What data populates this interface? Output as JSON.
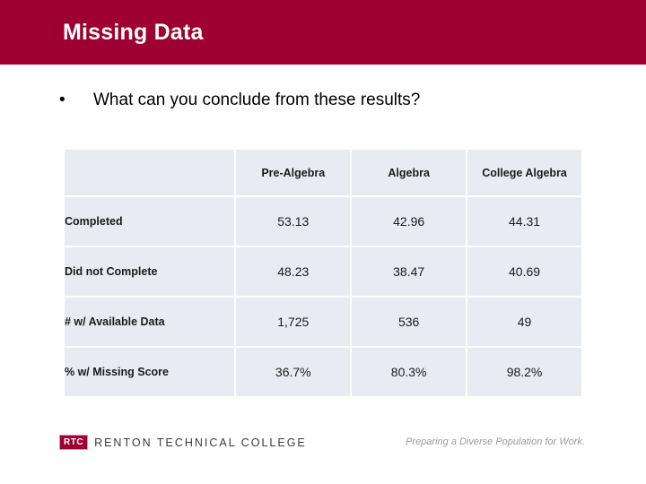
{
  "slide": {
    "title": "Missing Data",
    "banner_color": "#9E0033",
    "background_color": "#FFFFFF"
  },
  "body": {
    "bullet_marker": "•",
    "bullet_text": "What can you conclude from these results?"
  },
  "table": {
    "corner_label": "",
    "columns": [
      "Pre-Algebra",
      "Algebra",
      "College Algebra"
    ],
    "cell_background": "#E8ECF2",
    "rows": [
      {
        "label": "Completed",
        "values": [
          "53.13",
          "42.96",
          "44.31"
        ]
      },
      {
        "label": "Did not Complete",
        "values": [
          "48.23",
          "38.47",
          "40.69"
        ]
      },
      {
        "label": "# w/ Available Data",
        "values": [
          "1,725",
          "536",
          "49"
        ]
      },
      {
        "label": "% w/ Missing Score",
        "values": [
          "36.7%",
          "80.3%",
          "98.2%"
        ]
      }
    ]
  },
  "footer": {
    "logo_badge": "RTC",
    "logo_wordmark": "RENTON TECHNICAL COLLEGE",
    "tagline": "Preparing a Diverse Population for Work."
  }
}
